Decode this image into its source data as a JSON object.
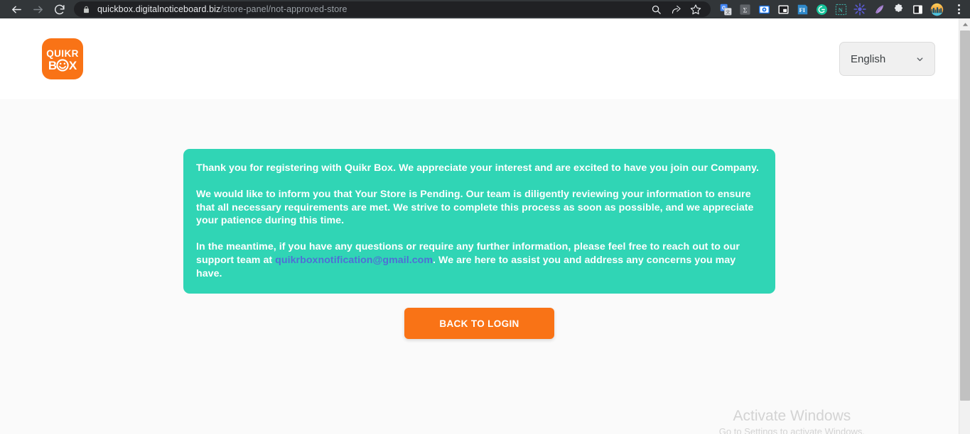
{
  "browser": {
    "back_icon": "back-arrow-icon",
    "forward_icon": "forward-arrow-icon",
    "reload_icon": "reload-icon",
    "lock_icon": "lock-icon",
    "url_domain": "quickbox.digitalnoticeboard.biz",
    "url_path": "/store-panel/not-approved-store",
    "omni_actions": [
      {
        "name": "search-icon",
        "title": "Search"
      },
      {
        "name": "share-icon",
        "title": "Share this page"
      },
      {
        "name": "bookmark-star-icon",
        "title": "Bookmark this tab"
      }
    ],
    "extensions": [
      {
        "name": "google-translate-icon",
        "title": "Google Translate"
      },
      {
        "name": "sigma-icon",
        "title": "Sigma"
      },
      {
        "name": "screen-recorder-icon",
        "title": "Screen Recorder"
      },
      {
        "name": "picture-in-picture-icon",
        "title": "Picture in Picture"
      },
      {
        "name": "fi-icon",
        "title": "FI"
      },
      {
        "name": "grammarly-icon",
        "title": "Grammarly"
      },
      {
        "name": "notion-web-clipper-icon",
        "title": "Notion Web Clipper"
      },
      {
        "name": "starburst-icon",
        "title": "Extension"
      },
      {
        "name": "quill-feather-icon",
        "title": "Extension"
      },
      {
        "name": "puzzle-piece-extensions-icon",
        "title": "Extensions"
      },
      {
        "name": "side-panel-icon",
        "title": "Side panel"
      },
      {
        "name": "profile-avatar-icon",
        "title": "Profile"
      }
    ],
    "menu_icon": "three-dot-menu-icon",
    "colors": {
      "chrome_bg": "#323639",
      "omnibox_bg": "#202124",
      "url_domain_color": "#e8eaed",
      "url_path_color": "#9aa0a6"
    }
  },
  "scrollbar": {
    "up_arrow_icon": "scroll-up-arrow-icon",
    "thumb": "scrollbar-thumb"
  },
  "header": {
    "logo": {
      "name": "quikr-box-logo",
      "line1": "QUIKR",
      "line2": "BOX",
      "bg_color": "#f97316"
    },
    "language_select": {
      "name": "language-select",
      "value": "English",
      "chevron_icon": "chevron-down-icon",
      "options": [
        "English"
      ]
    }
  },
  "main": {
    "notice": {
      "bg_color": "#30d5b5",
      "paragraph1": "Thank you for registering with Quikr Box. We appreciate your interest and are excited to have you join our Company.",
      "paragraph2": "We would like to inform you that Your Store is Pending. Our team is diligently reviewing your information to ensure that all necessary requirements are met. We strive to complete this process as soon as possible, and we appreciate your patience during this time.",
      "paragraph3_before": "In the meantime, if you have any questions or require any further information, please feel free to reach out to our support team at ",
      "paragraph3_link": "quikrboxnotification@gmail.com",
      "paragraph3_after": ". We are here to assist you and address any concerns you may have.",
      "link_color": "#4f6fd6"
    },
    "back_to_login_button": {
      "label": "BACK TO LOGIN",
      "bg_color": "#f97316"
    }
  },
  "watermark": {
    "title": "Activate Windows",
    "subtitle": "Go to Settings to activate Windows."
  }
}
